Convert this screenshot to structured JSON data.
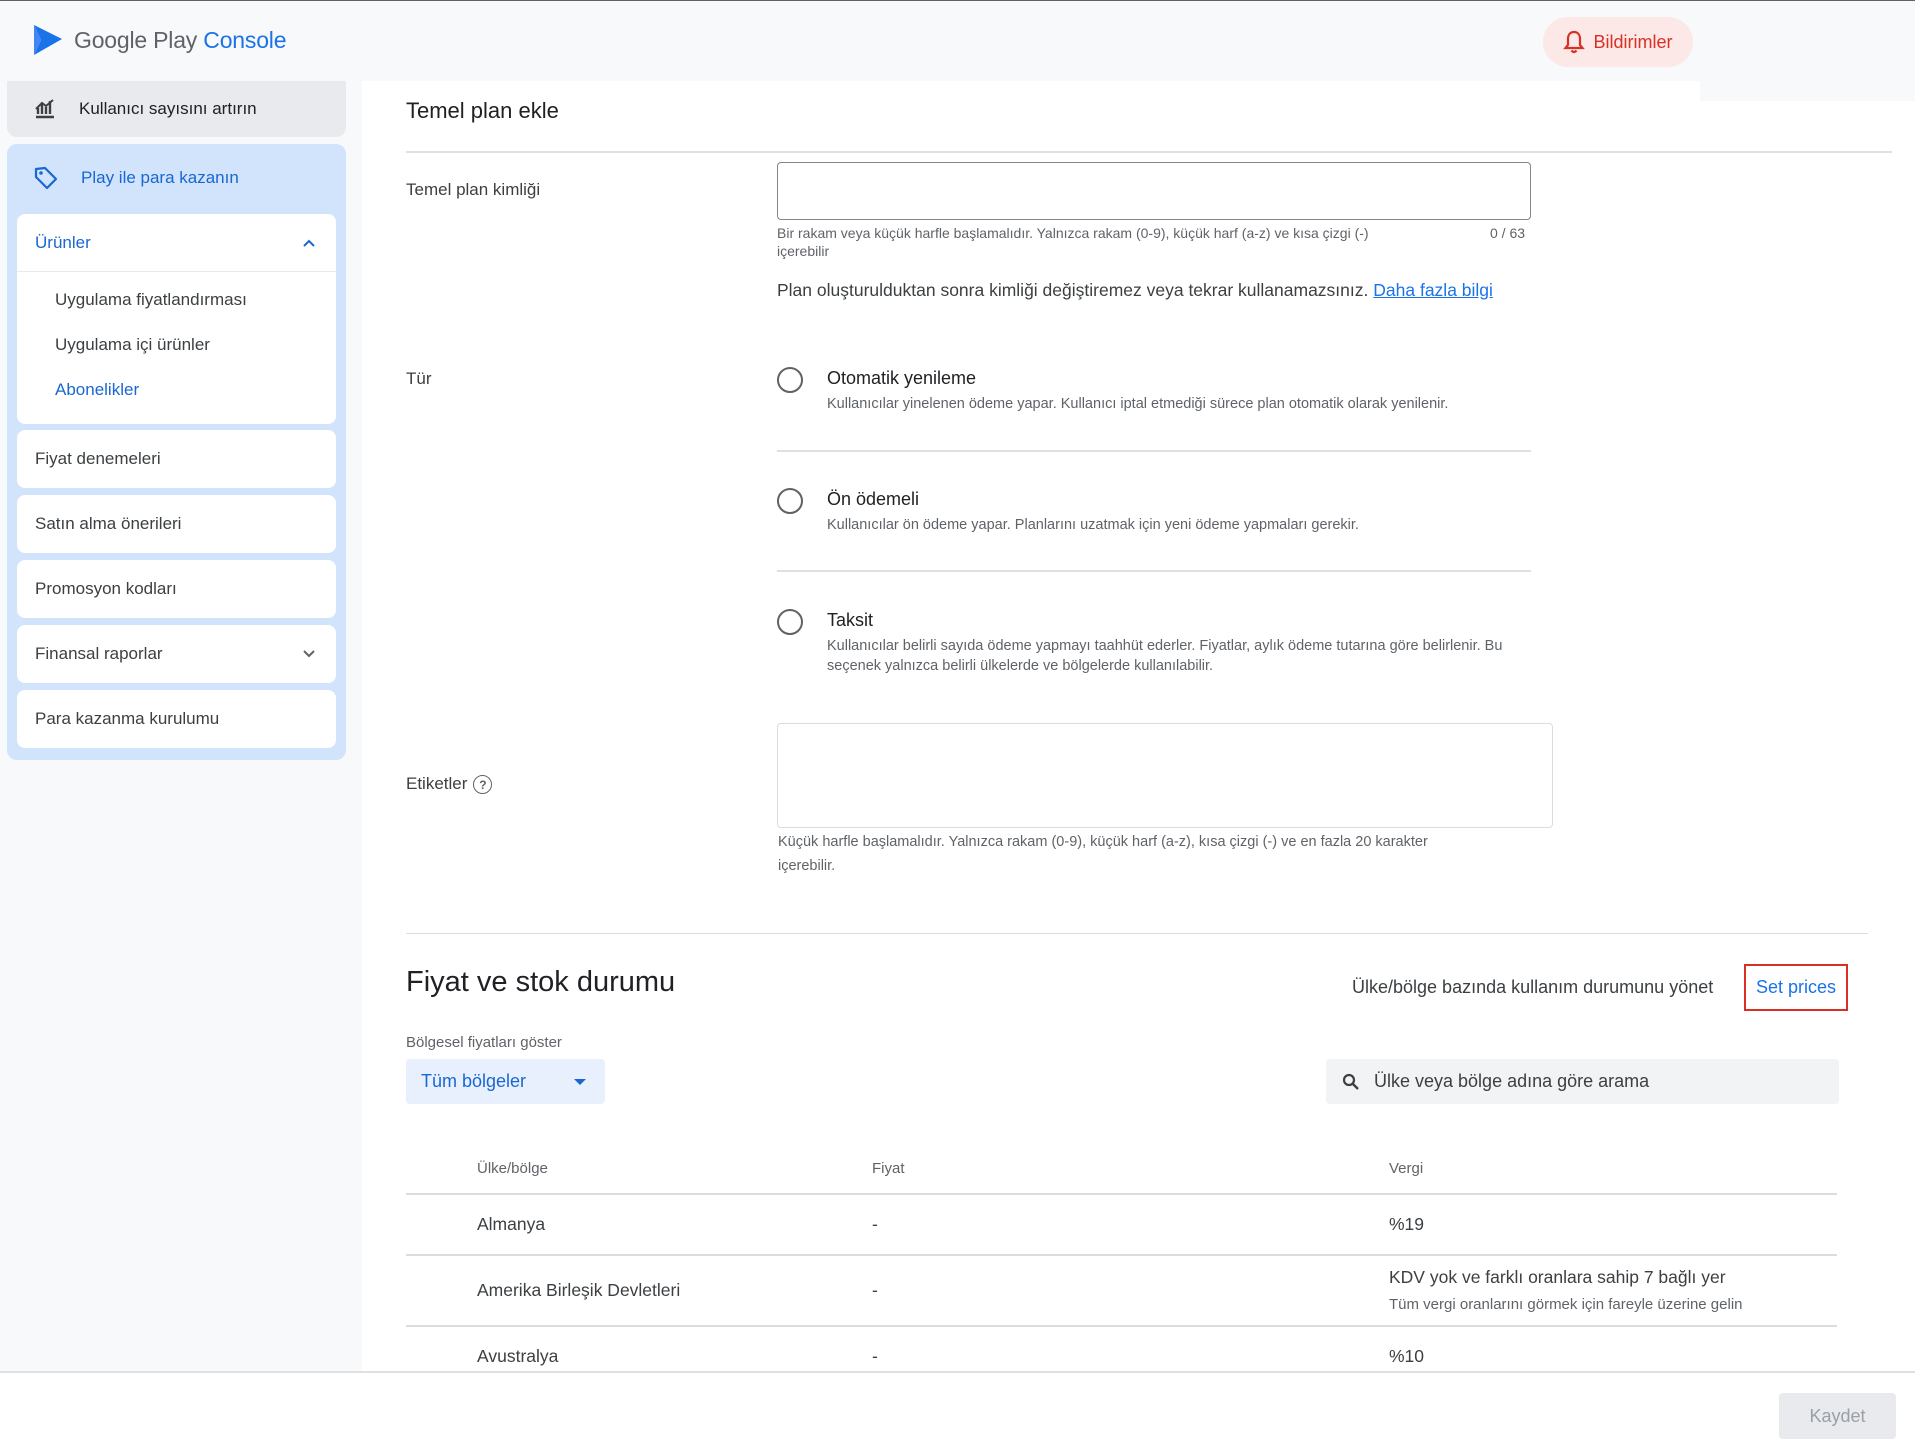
{
  "app": {
    "logo_text_main": "Google Play ",
    "logo_text_accent": "Console"
  },
  "header": {
    "notifications_label": "Bildirimler"
  },
  "sidebar": {
    "grow_users": "Kullanıcı sayısını artırın",
    "monetize": "Play ile para kazanın",
    "products": {
      "label": "Ürünler",
      "items": [
        "Uygulama fiyatlandırması",
        "Uygulama içi ürünler",
        "Abonelikler"
      ]
    },
    "cards": [
      "Fiyat denemeleri",
      "Satın alma önerileri",
      "Promosyon kodları",
      "Finansal raporlar",
      "Para kazanma kurulumu"
    ]
  },
  "form": {
    "title": "Temel plan ekle",
    "id_label": "Temel plan kimliği",
    "id_value": "",
    "id_hint_line1": "Bir rakam veya küçük harfle başlamalıdır. Yalnızca rakam (0-9), küçük harf (a-z) ve kısa çizgi (-)",
    "id_hint_line2": "içerebilir",
    "id_counter": "0 / 63",
    "id_note": "Plan oluşturulduktan sonra kimliği değiştiremez veya tekrar kullanamazsınız.",
    "learn_more": "Daha fazla bilgi",
    "type_label": "Tür",
    "types": [
      {
        "title": "Otomatik yenileme",
        "desc": "Kullanıcılar yinelenen ödeme yapar. Kullanıcı iptal etmediği sürece plan otomatik olarak yenilenir."
      },
      {
        "title": "Ön ödemeli",
        "desc": "Kullanıcılar ön ödeme yapar. Planlarını uzatmak için yeni ödeme yapmaları gerekir."
      },
      {
        "title": "Taksit",
        "desc": "Kullanıcılar belirli sayıda ödeme yapmayı taahhüt ederler. Fiyatlar, aylık ödeme tutarına göre belirlenir. Bu seçenek yalnızca belirli ülkelerde ve bölgelerde kullanılabilir."
      }
    ],
    "tags_label": "Etiketler",
    "tags_hint_line1": "Küçük harfle başlamalıdır. Yalnızca rakam (0-9), küçük harf (a-z), kısa çizgi (-) ve en fazla 20 karakter",
    "tags_hint_line2": "içerebilir."
  },
  "pricing": {
    "title": "Fiyat ve stok durumu",
    "manage_label": "Ülke/bölge bazında kullanım durumunu yönet",
    "set_prices": "Set prices",
    "region_label": "Bölgesel fiyatları göster",
    "region_selected": "Tüm bölgeler",
    "search_placeholder": "Ülke veya bölge adına göre arama",
    "columns": [
      "Ülke/bölge",
      "Fiyat",
      "Vergi"
    ],
    "rows": [
      {
        "country": "Almanya",
        "price": "-",
        "tax": "%19",
        "tax_sub": ""
      },
      {
        "country": "Amerika Birleşik Devletleri",
        "price": "-",
        "tax": "KDV yok ve farklı oranlara sahip 7 bağlı yer",
        "tax_sub": "Tüm vergi oranlarını görmek için fareyle üzerine gelin"
      },
      {
        "country": "Avustralya",
        "price": "-",
        "tax": "%10",
        "tax_sub": ""
      }
    ]
  },
  "footer": {
    "save_label": "Kaydet"
  }
}
